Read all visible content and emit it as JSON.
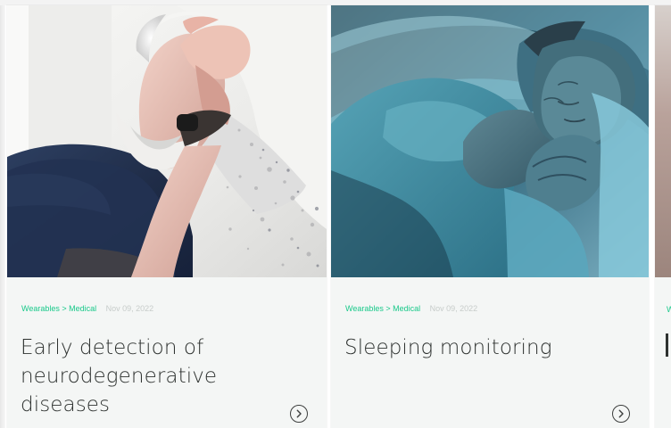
{
  "colors": {
    "accent": "#19c98a",
    "title": "#2e3230",
    "date": "#c7ccca",
    "card_background": "#f4f6f5"
  },
  "cards": [
    {
      "image_subject": "older man with hand on forehead dissolving into particles",
      "category_path": "Wearables > Medical",
      "date": "Nov 09, 2022",
      "title": "Early detection of neurodegenerative diseases",
      "link_icon": "chevron-right-circle-icon"
    },
    {
      "image_subject": "woman sleeping on a pillow",
      "category_path": "Wearables > Medical",
      "date": "Nov 09, 2022",
      "title": "Sleeping monitoring",
      "link_icon": "chevron-right-circle-icon"
    }
  ]
}
